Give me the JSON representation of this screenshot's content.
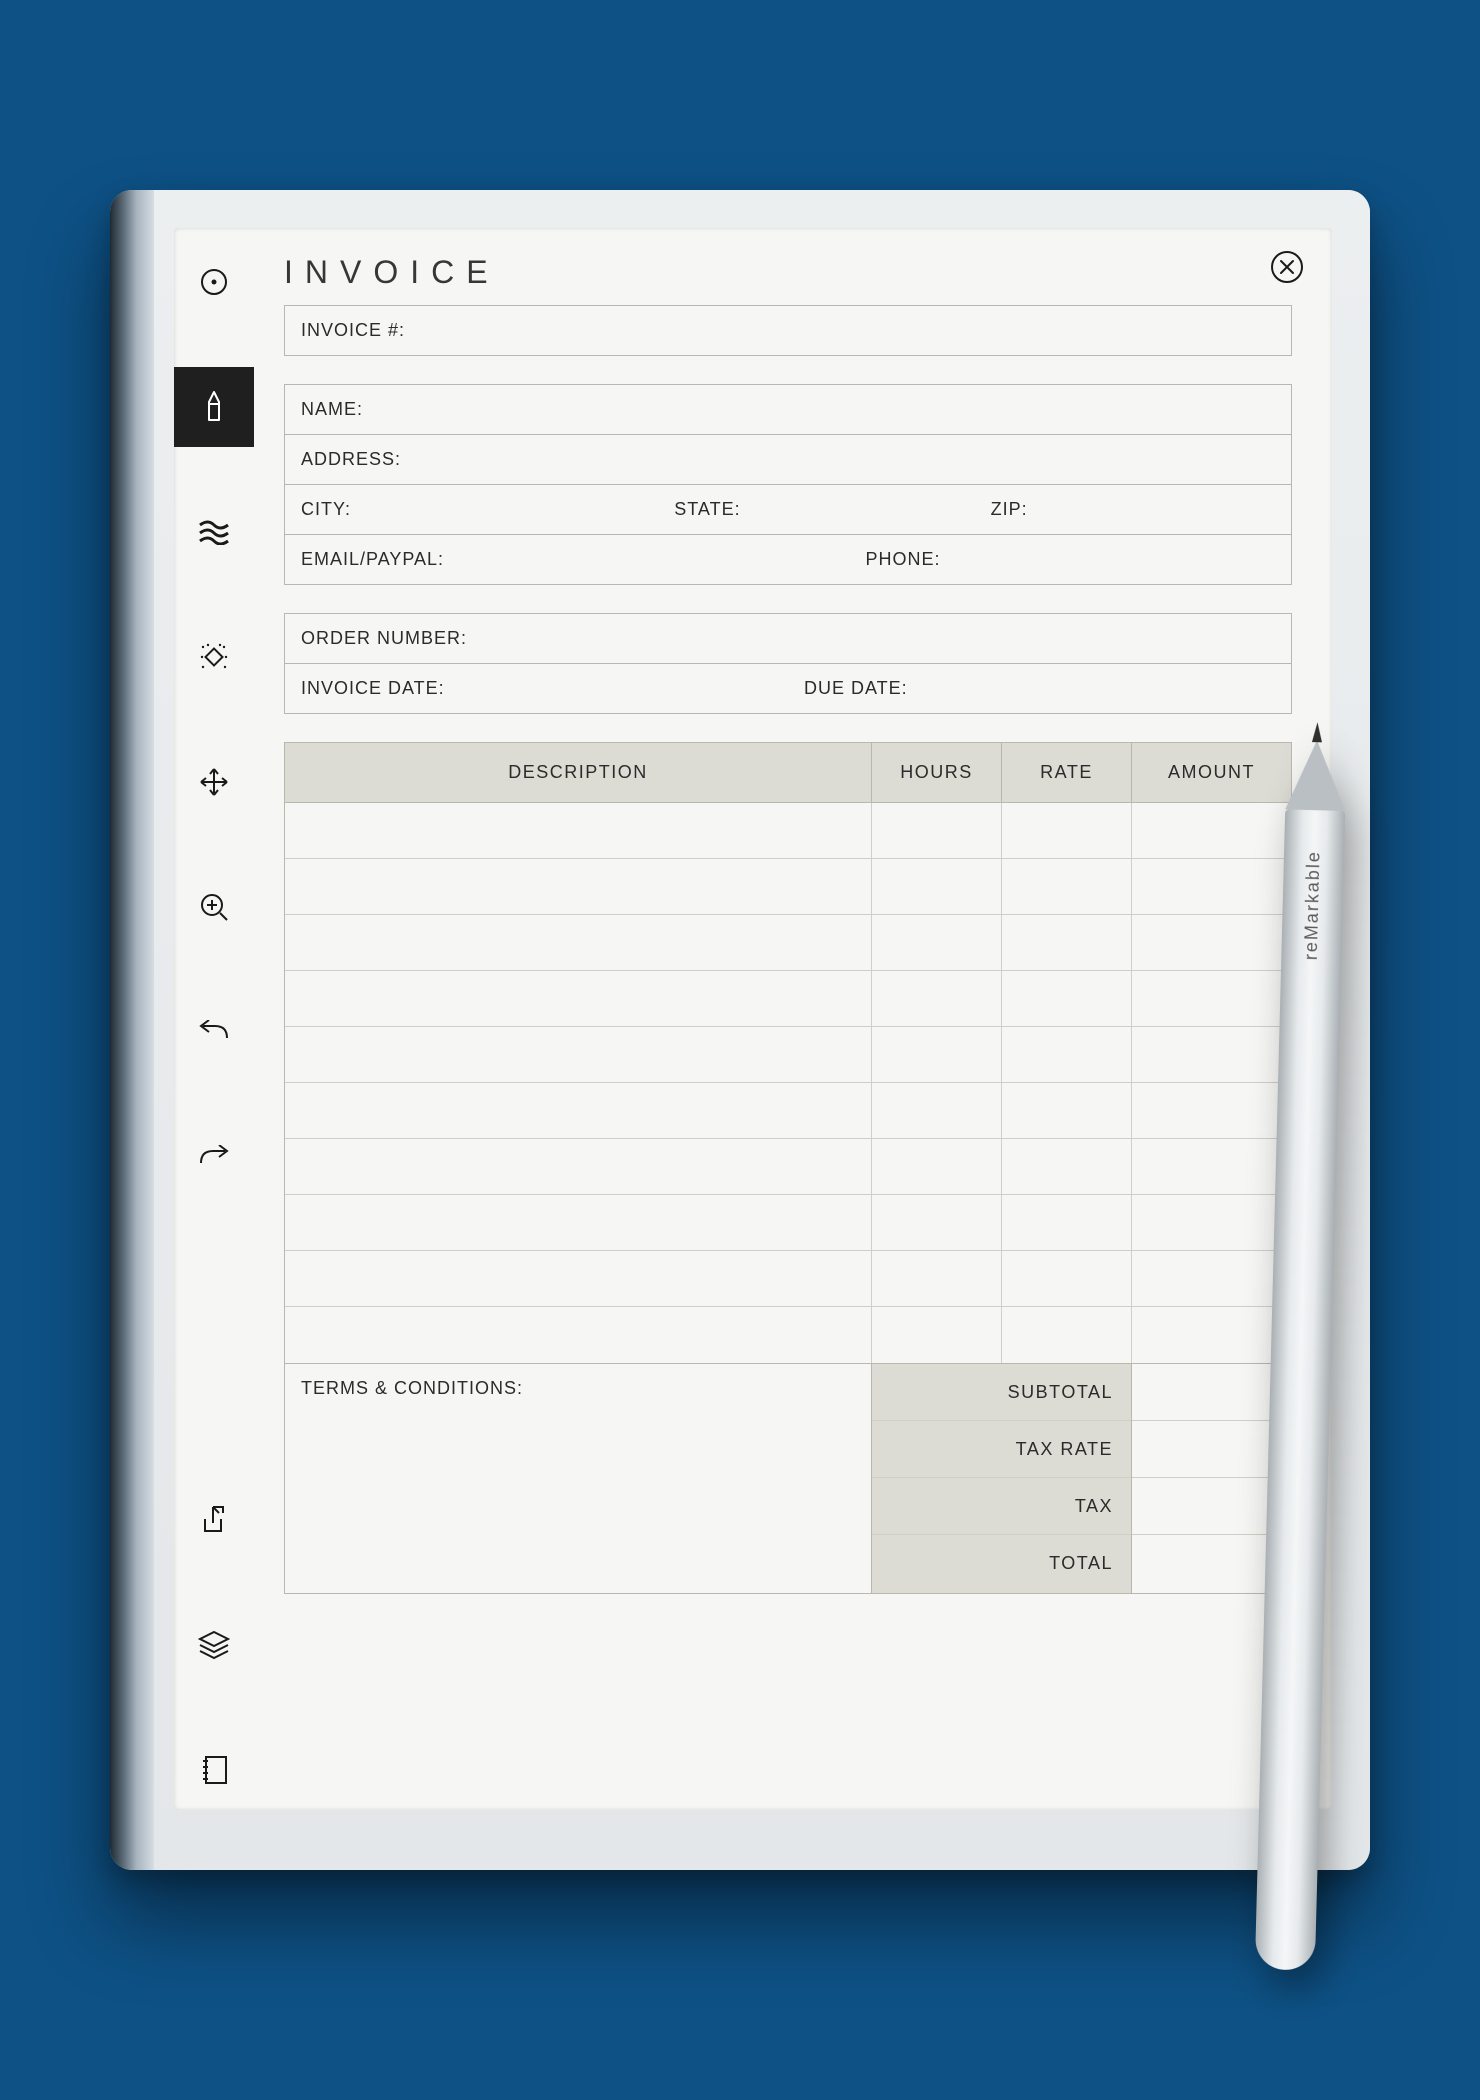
{
  "document": {
    "title": "INVOICE",
    "invoice_number_label": "INVOICE #:",
    "customer": {
      "name_label": "NAME:",
      "address_label": "ADDRESS:",
      "city_label": "CITY:",
      "state_label": "STATE:",
      "zip_label": "ZIP:",
      "email_label": "EMAIL/PAYPAL:",
      "phone_label": "PHONE:"
    },
    "order": {
      "order_number_label": "ORDER NUMBER:",
      "invoice_date_label": "INVOICE DATE:",
      "due_date_label": "DUE DATE:"
    },
    "table": {
      "headers": {
        "description": "DESCRIPTION",
        "hours": "HOURS",
        "rate": "RATE",
        "amount": "AMOUNT"
      },
      "row_count": 10
    },
    "footer": {
      "terms_label": "TERMS & CONDITIONS:",
      "subtotal_label": "SUBTOTAL",
      "tax_rate_label": "TAX RATE",
      "tax_label": "TAX",
      "total_label": "TOTAL"
    }
  },
  "toolbar": {
    "items": [
      {
        "name": "menu-icon"
      },
      {
        "name": "pen-icon",
        "active": true
      },
      {
        "name": "highlighter-icon"
      },
      {
        "name": "eraser-icon"
      },
      {
        "name": "move-icon"
      },
      {
        "name": "zoom-icon"
      },
      {
        "name": "undo-icon"
      },
      {
        "name": "redo-icon"
      }
    ],
    "bottom_items": [
      {
        "name": "export-icon"
      },
      {
        "name": "layers-icon"
      },
      {
        "name": "notebook-icon"
      }
    ]
  },
  "close_button": {
    "name": "close-icon"
  },
  "stylus": {
    "brand": "reMarkable"
  }
}
